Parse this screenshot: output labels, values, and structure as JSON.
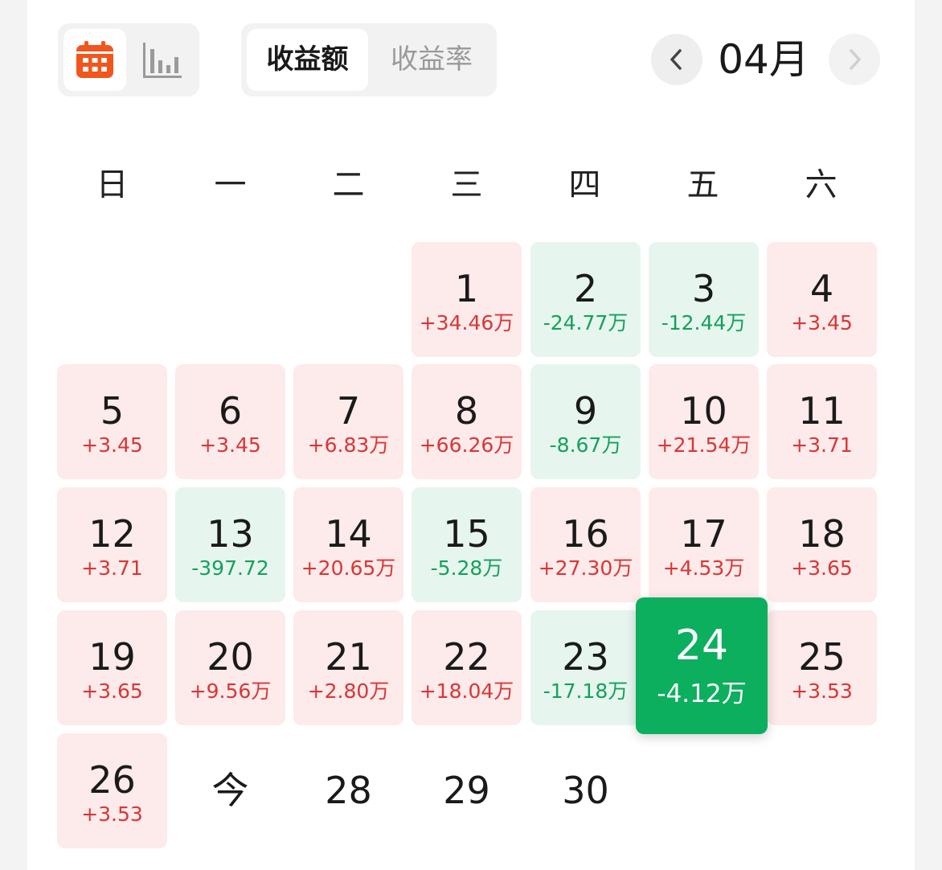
{
  "view_switch": {
    "calendar_icon": "calendar-icon",
    "chart_icon": "bar-chart-icon",
    "accent": "#f2561d"
  },
  "segment": {
    "active_label": "收益额",
    "inactive_label": "收益率"
  },
  "month_nav": {
    "prev_icon": "chevron-left-icon",
    "month": "04月",
    "next_icon": "chevron-right-icon"
  },
  "weekdays": [
    "日",
    "一",
    "二",
    "三",
    "四",
    "五",
    "六"
  ],
  "colors": {
    "up_bg": "#fdeaea",
    "up_text": "#d93636",
    "down_bg": "#e6f6ee",
    "down_text": "#16a05c",
    "selected_bg": "#0caf5e"
  },
  "days": [
    {
      "label": "1",
      "pnl": "+34.46万",
      "trend": "up"
    },
    {
      "label": "2",
      "pnl": "-24.77万",
      "trend": "down"
    },
    {
      "label": "3",
      "pnl": "-12.44万",
      "trend": "down"
    },
    {
      "label": "4",
      "pnl": "+3.45",
      "trend": "up"
    },
    {
      "label": "5",
      "pnl": "+3.45",
      "trend": "up"
    },
    {
      "label": "6",
      "pnl": "+3.45",
      "trend": "up"
    },
    {
      "label": "7",
      "pnl": "+6.83万",
      "trend": "up"
    },
    {
      "label": "8",
      "pnl": "+66.26万",
      "trend": "up"
    },
    {
      "label": "9",
      "pnl": "-8.67万",
      "trend": "down"
    },
    {
      "label": "10",
      "pnl": "+21.54万",
      "trend": "up"
    },
    {
      "label": "11",
      "pnl": "+3.71",
      "trend": "up"
    },
    {
      "label": "12",
      "pnl": "+3.71",
      "trend": "up"
    },
    {
      "label": "13",
      "pnl": "-397.72",
      "trend": "down"
    },
    {
      "label": "14",
      "pnl": "+20.65万",
      "trend": "up"
    },
    {
      "label": "15",
      "pnl": "-5.28万",
      "trend": "down"
    },
    {
      "label": "16",
      "pnl": "+27.30万",
      "trend": "up"
    },
    {
      "label": "17",
      "pnl": "+4.53万",
      "trend": "up"
    },
    {
      "label": "18",
      "pnl": "+3.65",
      "trend": "up"
    },
    {
      "label": "19",
      "pnl": "+3.65",
      "trend": "up"
    },
    {
      "label": "20",
      "pnl": "+9.56万",
      "trend": "up"
    },
    {
      "label": "21",
      "pnl": "+2.80万",
      "trend": "up"
    },
    {
      "label": "22",
      "pnl": "+18.04万",
      "trend": "up"
    },
    {
      "label": "23",
      "pnl": "-17.18万",
      "trend": "down"
    },
    {
      "label": "24",
      "pnl": "-4.12万",
      "trend": "selected"
    },
    {
      "label": "25",
      "pnl": "+3.53",
      "trend": "up"
    },
    {
      "label": "26",
      "pnl": "+3.53",
      "trend": "up"
    },
    {
      "label": "今",
      "pnl": "",
      "trend": "plain"
    },
    {
      "label": "28",
      "pnl": "",
      "trend": "plain"
    },
    {
      "label": "29",
      "pnl": "",
      "trend": "plain"
    },
    {
      "label": "30",
      "pnl": "",
      "trend": "plain"
    }
  ]
}
